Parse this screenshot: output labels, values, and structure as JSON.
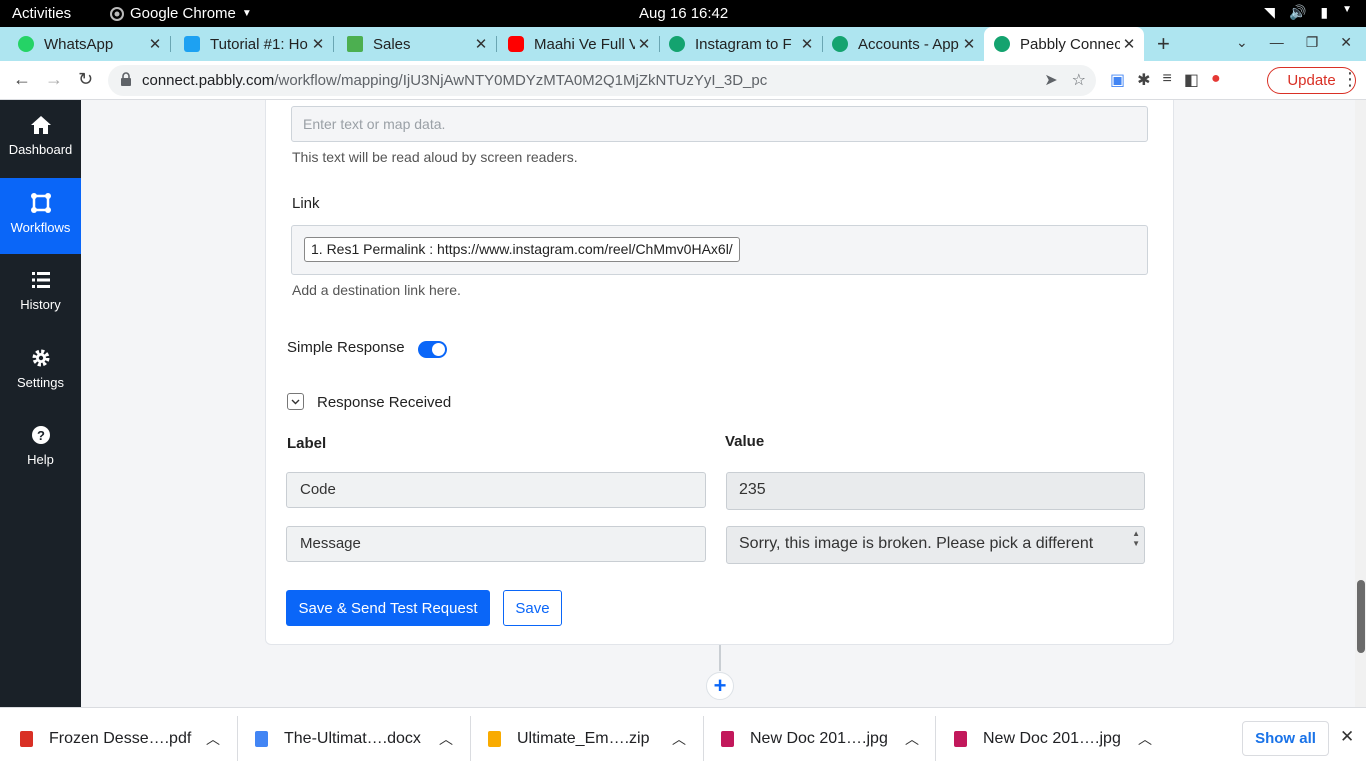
{
  "system_bar": {
    "activities": "Activities",
    "app_name": "Google Chrome",
    "clock": "Aug 16  16:42"
  },
  "tabs": [
    {
      "title": "WhatsApp",
      "icon": "whatsapp-icon",
      "color": "#25d366"
    },
    {
      "title": "Tutorial #1: Ho",
      "icon": "bird-icon",
      "color": "#1da1f2"
    },
    {
      "title": "Sales",
      "icon": "money-icon",
      "color": "#4caf50"
    },
    {
      "title": "Maahi Ve Full V",
      "icon": "youtube-icon",
      "color": "#ff0000"
    },
    {
      "title": "Instagram to F",
      "icon": "pabbly-icon",
      "color": "#14a36f"
    },
    {
      "title": "Accounts - App",
      "icon": "pabbly-icon",
      "color": "#14a36f"
    },
    {
      "title": "Pabbly Connec",
      "icon": "pabbly-icon",
      "color": "#14a36f"
    }
  ],
  "address_bar": {
    "domain": "connect.pabbly.com",
    "path": "/workflow/mapping/IjU3NjAwNTY0MDYzMTA0M2Q1MjZkNTUzYyI_3D_pc",
    "update_label": "Update"
  },
  "sidebar": {
    "items": [
      {
        "label": "Dashboard",
        "icon": "home-icon"
      },
      {
        "label": "Workflows",
        "icon": "workflow-icon"
      },
      {
        "label": "History",
        "icon": "list-icon"
      },
      {
        "label": "Settings",
        "icon": "gear-icon"
      },
      {
        "label": "Help",
        "icon": "help-icon"
      }
    ],
    "active": "Workflows"
  },
  "form": {
    "alt_text_placeholder": "Enter text or map data.",
    "alt_text_hint": "This text will be read aloud by screen readers.",
    "link_label": "Link",
    "link_value": "1. Res1 Permalink : https://www.instagram.com/reel/ChMmv0HAx6l/",
    "link_hint": "Add a destination link here.",
    "simple_response_label": "Simple Response",
    "simple_response_on": true,
    "response_received_label": "Response Received",
    "label_header": "Label",
    "value_header": "Value",
    "rows": [
      {
        "label": "Code",
        "value": "235"
      },
      {
        "label": "Message",
        "value": "Sorry, this image is broken. Please pick a different"
      }
    ],
    "save_test_label": "Save & Send Test Request",
    "save_label": "Save"
  },
  "downloads": [
    {
      "name": "Frozen Desse….pdf",
      "color": "#d93025"
    },
    {
      "name": "The-Ultimat….docx",
      "color": "#4285f4"
    },
    {
      "name": "Ultimate_Em….zip",
      "color": "#f9ab00"
    },
    {
      "name": "New Doc 201….jpg",
      "color": "#c2185b"
    },
    {
      "name": "New Doc 201….jpg",
      "color": "#c2185b"
    }
  ],
  "show_all_label": "Show all"
}
